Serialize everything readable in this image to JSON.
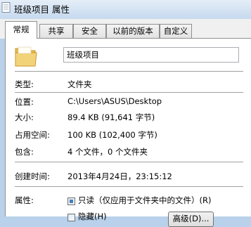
{
  "window": {
    "title": "班级项目 属性"
  },
  "tabs": [
    {
      "label": "常规"
    },
    {
      "label": "共享"
    },
    {
      "label": "安全"
    },
    {
      "label": "以前的版本"
    },
    {
      "label": "自定义"
    }
  ],
  "general": {
    "name_value": "班级项目",
    "type_label": "类型:",
    "type_value": "文件夹",
    "location_label": "位置:",
    "location_value": "C:\\Users\\ASUS\\Desktop",
    "size_label": "大小:",
    "size_value": "89.4 KB (91,641 字节)",
    "disk_size_label": "占用空间:",
    "disk_size_value": "100 KB (102,400 字节)",
    "contains_label": "包含:",
    "contains_value": "4 个文件，0 个文件夹",
    "created_label": "创建时间:",
    "created_value": "2013年4月24日，23:15:12",
    "attributes_label": "属性:",
    "readonly_label": "只读（仅应用于文件夹中的文件）(R)",
    "hidden_label": "隐藏(H)",
    "advanced_label": "高级(D)..."
  },
  "colors": {
    "accent": "#4a7eb8",
    "folder": "#f3d37a"
  }
}
